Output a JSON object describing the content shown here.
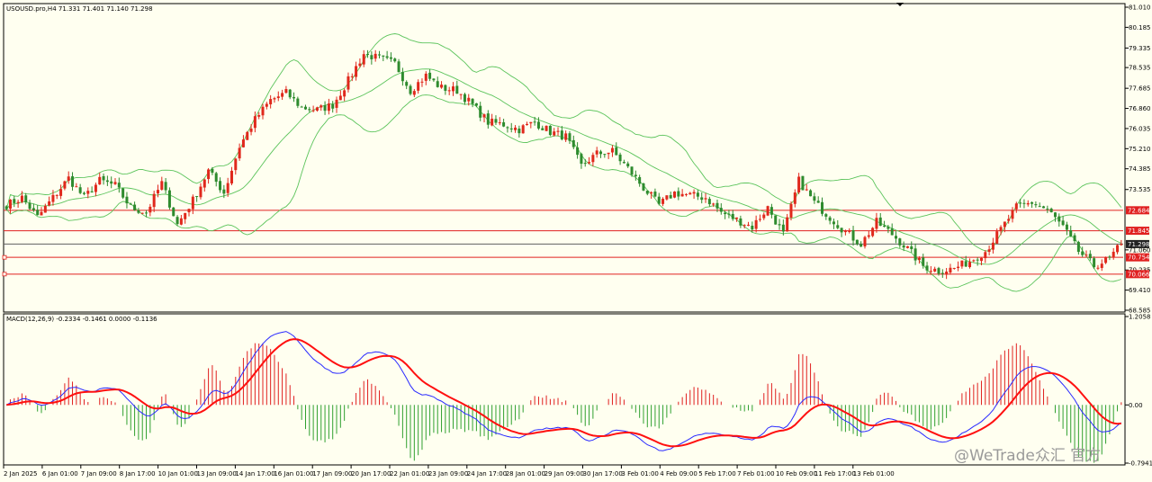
{
  "header": {
    "symbol_line": "USOUSD.pro,H4  71.331 71.401 71.140 71.298",
    "macd_line": "MACD(12,26,9) -0.2334 -0.1461 0.0000 -0.1136"
  },
  "watermark": "@WeTrade众汇 官方",
  "colors": {
    "background": "#fffff0",
    "bull": "#e0281c",
    "bear": "#2e8b2e",
    "bands": "#5cc45c",
    "hline": "#e02020",
    "price_line": "#606060",
    "macd_main": "#2a2aff",
    "macd_signal": "#ff1010",
    "hist_pos": "#e02020",
    "hist_neg": "#30a030"
  },
  "chart_data": [
    {
      "type": "candlestick",
      "title": "USOUSD.pro,H4",
      "ylim": [
        68.585,
        81.01
      ],
      "y_ticks": [
        "81.010",
        "80.185",
        "79.335",
        "78.535",
        "77.685",
        "76.860",
        "76.035",
        "75.210",
        "74.385",
        "73.535",
        "71.060",
        "70.235",
        "69.410",
        "68.585"
      ],
      "x_ticks": [
        "2 Jan 2025",
        "6 Jan 01:00",
        "7 Jan 09:00",
        "8 Jan 17:00",
        "10 Jan 01:00",
        "13 Jan 09:00",
        "14 Jan 17:00",
        "16 Jan 01:00",
        "17 Jan 09:00",
        "20 Jan 17:00",
        "22 Jan 01:00",
        "23 Jan 09:00",
        "24 Jan 17:00",
        "28 Jan 01:00",
        "29 Jan 09:00",
        "30 Jan 17:00",
        "3 Feb 01:00",
        "4 Feb 09:00",
        "5 Feb 17:00",
        "7 Feb 01:00",
        "10 Feb 09:00",
        "11 Feb 17:00",
        "13 Feb 01:00"
      ],
      "current_price": "71.298",
      "levels": [
        {
          "value": "72.684",
          "marker": false
        },
        {
          "value": "71.845",
          "marker": false
        },
        {
          "value": "70.754",
          "marker": true
        },
        {
          "value": "70.066",
          "marker": true
        }
      ],
      "close_path": [
        [
          0,
          72.9
        ],
        [
          4,
          73.2
        ],
        [
          8,
          72.4
        ],
        [
          12,
          73.2
        ],
        [
          16,
          74.0
        ],
        [
          20,
          73.2
        ],
        [
          24,
          73.9
        ],
        [
          28,
          73.7
        ],
        [
          32,
          72.8
        ],
        [
          36,
          72.6
        ],
        [
          40,
          73.8
        ],
        [
          44,
          72.1
        ],
        [
          48,
          73.1
        ],
        [
          52,
          74.3
        ],
        [
          56,
          73.4
        ],
        [
          60,
          75.3
        ],
        [
          64,
          76.4
        ],
        [
          68,
          77.2
        ],
        [
          72,
          77.5
        ],
        [
          76,
          76.9
        ],
        [
          80,
          76.8
        ],
        [
          84,
          77.0
        ],
        [
          88,
          78.0
        ],
        [
          92,
          79.1
        ],
        [
          96,
          78.9
        ],
        [
          100,
          78.7
        ],
        [
          104,
          77.6
        ],
        [
          108,
          78.2
        ],
        [
          112,
          77.7
        ],
        [
          116,
          77.6
        ],
        [
          120,
          77.0
        ],
        [
          124,
          76.3
        ],
        [
          128,
          76.2
        ],
        [
          132,
          76.0
        ],
        [
          136,
          76.3
        ],
        [
          140,
          75.9
        ],
        [
          144,
          75.7
        ],
        [
          148,
          74.5
        ],
        [
          152,
          75.0
        ],
        [
          156,
          75.1
        ],
        [
          160,
          74.4
        ],
        [
          164,
          73.6
        ],
        [
          168,
          72.9
        ],
        [
          172,
          73.4
        ],
        [
          176,
          73.3
        ],
        [
          180,
          73.2
        ],
        [
          184,
          72.6
        ],
        [
          188,
          72.3
        ],
        [
          192,
          72.0
        ],
        [
          196,
          72.8
        ],
        [
          200,
          71.7
        ],
        [
          204,
          73.9
        ],
        [
          208,
          73.0
        ],
        [
          212,
          72.4
        ],
        [
          216,
          71.8
        ],
        [
          220,
          71.3
        ],
        [
          224,
          72.2
        ],
        [
          228,
          71.7
        ],
        [
          232,
          71.1
        ],
        [
          236,
          70.4
        ],
        [
          240,
          70.2
        ],
        [
          244,
          70.3
        ],
        [
          248,
          70.6
        ],
        [
          252,
          71.0
        ],
        [
          256,
          71.9
        ],
        [
          260,
          72.8
        ],
        [
          264,
          73.0
        ],
        [
          268,
          72.7
        ],
        [
          272,
          72.0
        ],
        [
          276,
          71.0
        ],
        [
          280,
          70.4
        ],
        [
          284,
          70.7
        ],
        [
          287,
          71.298
        ]
      ],
      "n_bars": 288
    },
    {
      "type": "macd_histogram",
      "title": "MACD(12,26,9)",
      "values": [
        "-0.2334",
        "-0.1461",
        "0.0000",
        "-0.1136"
      ],
      "ylim": [
        -0.7941,
        1.2058
      ],
      "y_ticks": [
        "1.2058",
        "0.00",
        "-0.7941"
      ]
    }
  ]
}
